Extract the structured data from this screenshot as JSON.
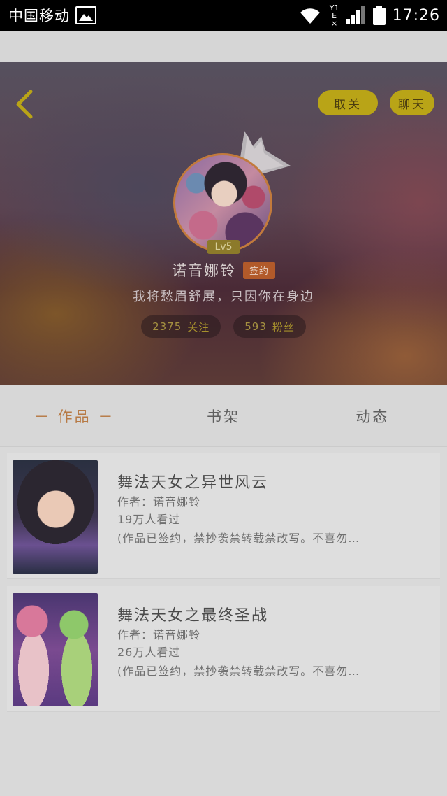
{
  "status_bar": {
    "carrier": "中国移动",
    "time": "17:26",
    "network_top": "Y1 E",
    "network_bottom": "×"
  },
  "header": {
    "buttons": {
      "unfollow": "取关",
      "chat": "聊天"
    },
    "level": "Lv5",
    "username": "诺音娜铃",
    "signed_badge": "签约",
    "motto": "我将愁眉舒展，只因你在身边",
    "stats": [
      {
        "count": "2375",
        "label": "关注"
      },
      {
        "count": "593",
        "label": "粉丝"
      }
    ]
  },
  "tabs": [
    {
      "label": "－ 作品 －",
      "active": true
    },
    {
      "label": "书架",
      "active": false
    },
    {
      "label": "动态",
      "active": false
    }
  ],
  "works": [
    {
      "title": "舞法天女之异世风云",
      "author": "作者：诺音娜铃",
      "views": "19万人看过",
      "desc": "(作品已签约，禁抄袭禁转载禁改写。不喜勿…"
    },
    {
      "title": "舞法天女之最终圣战",
      "author": "作者：诺音娜铃",
      "views": "26万人看过",
      "desc": "(作品已签约，禁抄袭禁转载禁改写。不喜勿…"
    }
  ],
  "colors": {
    "accent_yellow": "#b9a417",
    "active_tab": "#b77a45",
    "signed_badge": "#b25a2a"
  }
}
